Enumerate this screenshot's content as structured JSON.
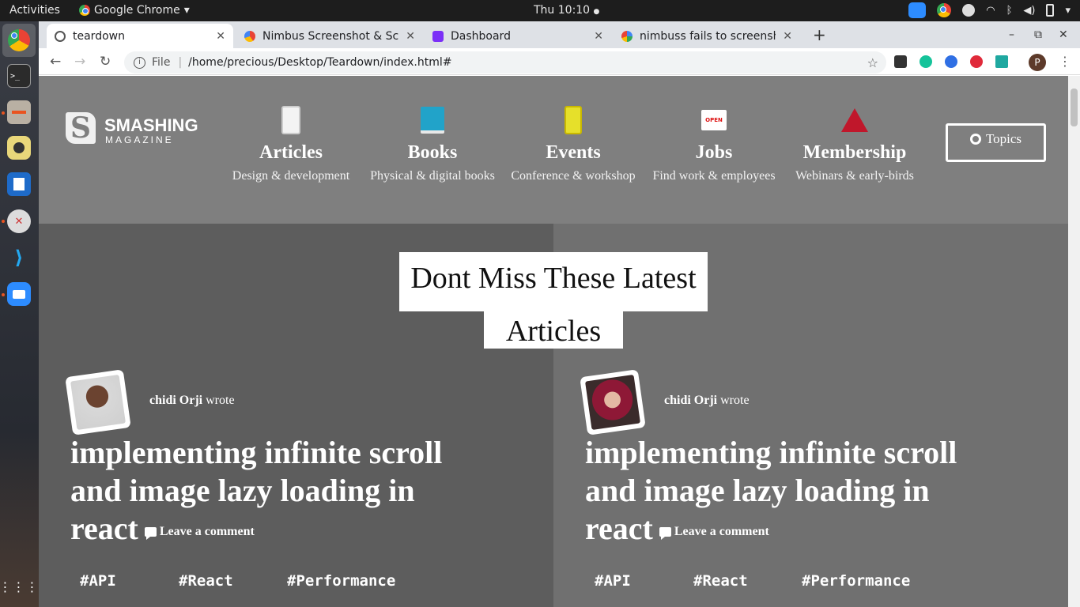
{
  "system": {
    "activities": "Activities",
    "app_name": "Google Chrome",
    "app_arrow": "▾",
    "clock": "Thu 10:10",
    "clock_dot": "●",
    "tray_icons": [
      "zoom-icon",
      "chrome-icon",
      "update-icon",
      "wifi-icon",
      "bluetooth-icon",
      "volume-icon",
      "battery-icon",
      "power-menu-icon"
    ]
  },
  "dock": {
    "items": [
      "chrome",
      "terminal",
      "files",
      "rhythmbox",
      "writer",
      "settings",
      "vscode",
      "zoom"
    ],
    "grid_icon": "show-applications-icon"
  },
  "browser": {
    "tabs": [
      {
        "title": "teardown",
        "close": "✕",
        "active": true
      },
      {
        "title": "Nimbus Screenshot & Scre",
        "close": "✕",
        "active": false
      },
      {
        "title": "Dashboard",
        "close": "✕",
        "active": false
      },
      {
        "title": "nimbuss fails to screensh",
        "close": "✕",
        "active": false
      }
    ],
    "new_tab": "+",
    "window_controls": [
      "–",
      "⧉",
      "✕"
    ],
    "url_scheme_label": "File",
    "url": "/home/precious/Desktop/Teardown/index.html#",
    "profile_initial": "P"
  },
  "site": {
    "logo_top": "SMASHING",
    "logo_bottom": "MAGAZINE",
    "logo_letter": "S",
    "nav": [
      {
        "title": "Articles",
        "subtitle": "Design & development",
        "icon": "tablet-icon"
      },
      {
        "title": "Books",
        "subtitle": "Physical & digital books",
        "icon": "book-icon"
      },
      {
        "title": "Events",
        "subtitle": "Conference & workshop",
        "icon": "ticket-icon"
      },
      {
        "title": "Jobs",
        "subtitle": "Find work & employees",
        "icon": "open-sign-icon"
      },
      {
        "title": "Membership",
        "subtitle": "Webinars & early-birds",
        "icon": "circus-tent-icon"
      }
    ],
    "open_sign": "OPEN",
    "topics": "Topics",
    "headline_line1": "Dont Miss These Latest",
    "headline_line2": "Articles",
    "articles": [
      {
        "author": "chidi Orji",
        "wrote": "wrote",
        "title": "implementing infinite scroll and image lazy loading in react",
        "comment": "Leave a comment",
        "tags": [
          "#API",
          "#React",
          "#Performance"
        ]
      },
      {
        "author": "chidi Orji",
        "wrote": "wrote",
        "title": "implementing infinite scroll and image lazy loading in react",
        "comment": "Leave a comment",
        "tags": [
          "#API",
          "#React",
          "#Performance"
        ]
      }
    ]
  }
}
